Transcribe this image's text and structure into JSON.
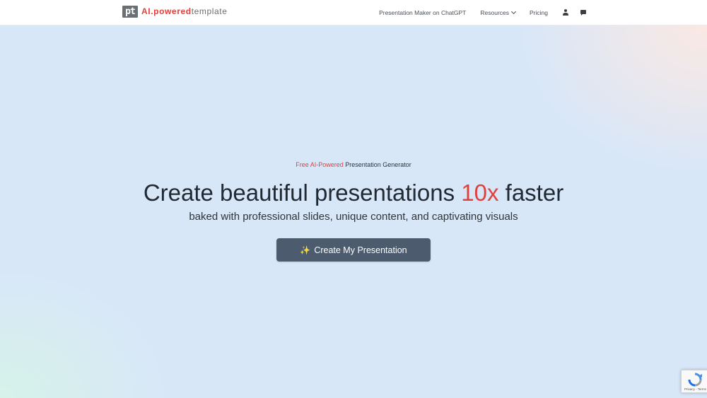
{
  "header": {
    "logo": {
      "mark": "pt",
      "text_accent": "AI.powered",
      "text_rest": "template"
    },
    "nav": {
      "items": [
        {
          "label": "Presentation Maker on ChatGPT"
        },
        {
          "label": "Resources",
          "has_dropdown": true
        },
        {
          "label": "Pricing"
        }
      ],
      "icons": [
        "user-icon",
        "chat-icon"
      ]
    }
  },
  "hero": {
    "eyebrow_accent": "Free AI-Powered",
    "eyebrow_rest": " Presentation Generator",
    "headline_before": "Create beautiful presentations ",
    "headline_accent": "10x",
    "headline_after": " faster",
    "subline": "baked with professional slides, unique content, and captivating visuals",
    "cta": {
      "icon": "sparkle-icon",
      "icon_glyph": "✨",
      "label": "Create My Presentation"
    }
  },
  "recaptcha": {
    "text": "Privacy - Terms"
  },
  "colors": {
    "accent": "#e0413c",
    "cta_bg": "#4c5b6d",
    "hero_bg": "#d8e7f8",
    "text_dark": "#212a33"
  }
}
